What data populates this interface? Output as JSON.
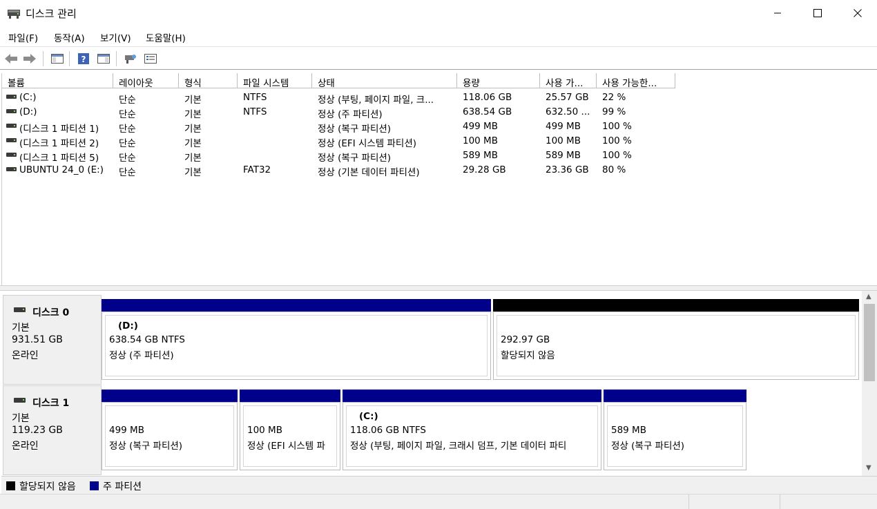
{
  "window": {
    "title": "디스크 관리"
  },
  "menu": {
    "items": [
      "파일(F)",
      "동작(A)",
      "보기(V)",
      "도움말(H)"
    ]
  },
  "toolbar": {
    "buttons": [
      "back-icon",
      "forward-icon",
      "console-tree-icon",
      "help-icon",
      "action-pane-icon",
      "connect-icon",
      "properties-icon"
    ]
  },
  "volumes": {
    "columns": [
      "볼륨",
      "레이아웃",
      "형식",
      "파일 시스템",
      "상태",
      "용량",
      "사용 가...",
      "사용 가능한..."
    ],
    "rows": [
      {
        "volume": " (C:)",
        "layout": "단순",
        "type": "기본",
        "fs": "NTFS",
        "status": "정상 (부팅, 페이지 파일, 크...",
        "capacity": "118.06 GB",
        "free": "25.57 GB",
        "pct": "22 %"
      },
      {
        "volume": " (D:)",
        "layout": "단순",
        "type": "기본",
        "fs": "NTFS",
        "status": "정상 (주 파티션)",
        "capacity": "638.54 GB",
        "free": "632.50 ...",
        "pct": "99 %"
      },
      {
        "volume": "(디스크 1 파티션 1)",
        "layout": "단순",
        "type": "기본",
        "fs": "",
        "status": "정상 (복구 파티션)",
        "capacity": "499 MB",
        "free": "499 MB",
        "pct": "100 %"
      },
      {
        "volume": "(디스크 1 파티션 2)",
        "layout": "단순",
        "type": "기본",
        "fs": "",
        "status": "정상 (EFI 시스템 파티션)",
        "capacity": "100 MB",
        "free": "100 MB",
        "pct": "100 %"
      },
      {
        "volume": "(디스크 1 파티션 5)",
        "layout": "단순",
        "type": "기본",
        "fs": "",
        "status": "정상 (복구 파티션)",
        "capacity": "589 MB",
        "free": "589 MB",
        "pct": "100 %"
      },
      {
        "volume": "UBUNTU 24_0 (E:)",
        "layout": "단순",
        "type": "기본",
        "fs": "FAT32",
        "status": "정상 (기본 데이터 파티션)",
        "capacity": "29.28 GB",
        "free": "23.36 GB",
        "pct": "80 %"
      }
    ]
  },
  "disks": [
    {
      "name": "디스크 0",
      "type": "기본",
      "size": "931.51 GB",
      "state": "온라인",
      "partitions": [
        {
          "name": "(D:)",
          "line1": "638.54 GB NTFS",
          "line2": "정상 (주 파티션)",
          "kind": "primary"
        },
        {
          "name": "",
          "line1": "292.97 GB",
          "line2": "할당되지 않음",
          "kind": "unallocated"
        }
      ]
    },
    {
      "name": "디스크 1",
      "type": "기본",
      "size": "119.23 GB",
      "state": "온라인",
      "partitions": [
        {
          "name": "",
          "line1": "499 MB",
          "line2": "정상 (복구 파티션)",
          "kind": "primary"
        },
        {
          "name": "",
          "line1": "100 MB",
          "line2": "정상 (EFI 시스템 파",
          "kind": "primary"
        },
        {
          "name": "(C:)",
          "line1": "118.06 GB NTFS",
          "line2": "정상 (부팅, 페이지 파일, 크래시 덤프, 기본 데이터 파티",
          "kind": "primary"
        },
        {
          "name": "",
          "line1": "589 MB",
          "line2": "정상 (복구 파티션)",
          "kind": "primary"
        }
      ]
    }
  ],
  "legend": [
    {
      "label": "할당되지 않음",
      "color": "#000000"
    },
    {
      "label": "주 파티션",
      "color": "#00008b"
    }
  ],
  "colors": {
    "primary": "#00008b",
    "unallocated": "#000000"
  }
}
